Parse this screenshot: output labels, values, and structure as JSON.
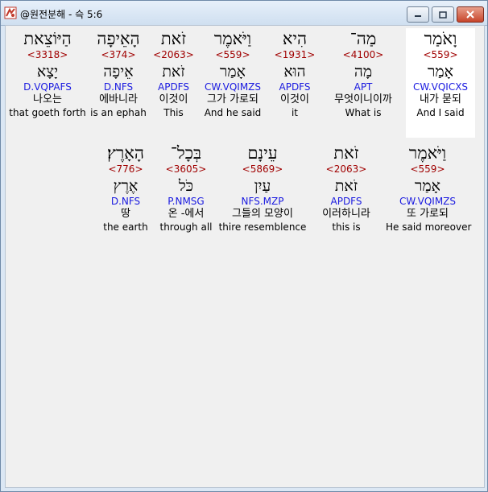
{
  "window": {
    "title": "@원전분해 - 슥 5:6",
    "min_icon": "minimize-icon",
    "max_icon": "maximize-icon",
    "close_icon": "close-icon"
  },
  "rows": [
    [
      {
        "heb": "וָאֹמַר",
        "strong": "<559>",
        "lemma": "אָמַר",
        "parse": "CW.VQICXS",
        "kor": "내가 묻되",
        "eng": "And I said",
        "selected": true
      },
      {
        "heb": "מַה־",
        "strong": "<4100>",
        "lemma": "מָה",
        "parse": "APT",
        "kor": "무엇이니이까",
        "eng": "What is"
      },
      {
        "heb": "הִיא",
        "strong": "<1931>",
        "lemma": "הוּא",
        "parse": "APDFS",
        "kor": "이것이",
        "eng": "it"
      },
      {
        "heb": "וַיֹּאמֶר",
        "strong": "<559>",
        "lemma": "אָמַר",
        "parse": "CW.VQIMZS",
        "kor": "그가 가로되",
        "eng": "And he said"
      },
      {
        "heb": "זֹאת",
        "strong": "<2063>",
        "lemma": "זֹאת",
        "parse": "APDFS",
        "kor": "이것이",
        "eng": "This"
      },
      {
        "heb": "הָאֵיפָה",
        "strong": "<374>",
        "lemma": "אֵיפָה",
        "parse": "D.NFS",
        "kor": "에바니라",
        "eng": "is an ephah"
      },
      {
        "heb": "הַיּוֹצֵאת",
        "strong": "<3318>",
        "lemma": "יָצָא",
        "parse": "D.VQPAFS",
        "kor": "나오는",
        "eng": "that goeth forth"
      }
    ],
    [
      {
        "heb": "וַיֹּאמֶר",
        "strong": "<559>",
        "lemma": "אָמַר",
        "parse": "CW.VQIMZS",
        "kor": "또 가로되",
        "eng": "He said moreover"
      },
      {
        "heb": "זֹאת",
        "strong": "<2063>",
        "lemma": "זֹאת",
        "parse": "APDFS",
        "kor": "이러하니라",
        "eng": "this is"
      },
      {
        "heb": "עֵינָם",
        "strong": "<5869>",
        "lemma": "עַיִן",
        "parse": "NFS.MZP",
        "kor": "그들의 모양이",
        "eng": "thire resemblence"
      },
      {
        "heb": "בְּכָל־",
        "strong": "<3605>",
        "lemma": "כֹּל",
        "parse": "P.NMSG",
        "kor": "온 -에서",
        "eng": "through all"
      },
      {
        "heb": "הָאָרֶץ׃",
        "strong": "<776>",
        "lemma": "אֶרֶץ",
        "parse": "D.NFS",
        "kor": "땅",
        "eng": "the earth"
      }
    ]
  ]
}
